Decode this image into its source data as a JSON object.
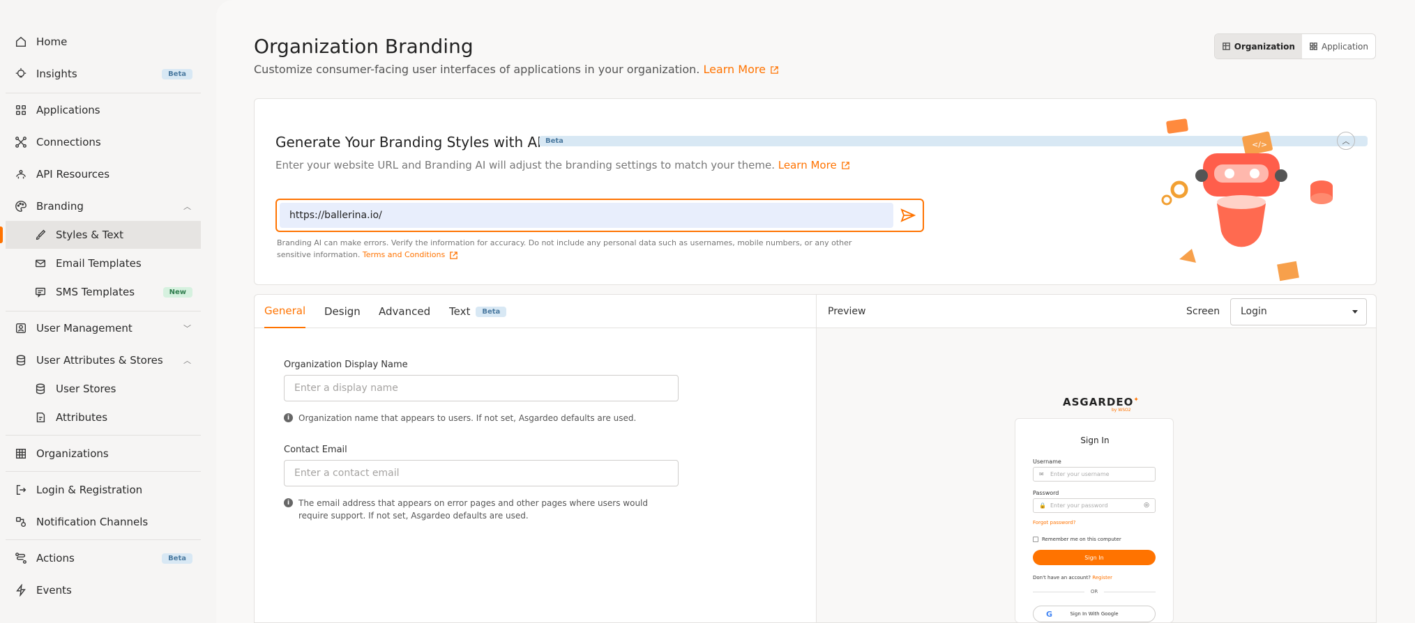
{
  "sidebar": {
    "items": [
      {
        "label": "Home",
        "icon": "home-icon"
      },
      {
        "label": "Insights",
        "icon": "bulb-icon",
        "badge": "Beta"
      },
      {
        "label": "Applications",
        "icon": "grid-icon"
      },
      {
        "label": "Connections",
        "icon": "connections-icon"
      },
      {
        "label": "API Resources",
        "icon": "api-icon"
      },
      {
        "label": "Branding",
        "icon": "palette-icon"
      },
      {
        "label": "Styles & Text",
        "icon": "brush-icon"
      },
      {
        "label": "Email Templates",
        "icon": "mail-icon"
      },
      {
        "label": "SMS Templates",
        "icon": "sms-icon",
        "badge": "New"
      },
      {
        "label": "User Management",
        "icon": "user-icon"
      },
      {
        "label": "User Attributes & Stores",
        "icon": "database-icon"
      },
      {
        "label": "User Stores",
        "icon": "database-icon"
      },
      {
        "label": "Attributes",
        "icon": "attribute-icon"
      },
      {
        "label": "Organizations",
        "icon": "building-icon"
      },
      {
        "label": "Login & Registration",
        "icon": "login-icon"
      },
      {
        "label": "Notification Channels",
        "icon": "channels-icon"
      },
      {
        "label": "Actions",
        "icon": "actions-icon",
        "badge": "Beta"
      },
      {
        "label": "Events",
        "icon": "bolt-icon"
      }
    ]
  },
  "header": {
    "title": "Organization Branding",
    "subtitle": "Customize consumer-facing user interfaces of applications in your organization.",
    "learn_more": "Learn More",
    "toggle": {
      "organization": "Organization",
      "application": "Application"
    }
  },
  "ai": {
    "title": "Generate Your Branding Styles with AI",
    "badge": "Beta",
    "description": "Enter your website URL and Branding AI will adjust the branding settings to match your theme.",
    "learn_more": "Learn More",
    "url_value": "https://ballerina.io/",
    "disclaimer": "Branding AI can make errors. Verify the information for accuracy. Do not include any personal data such as usernames, mobile numbers, or any other sensitive information.",
    "terms": "Terms and Conditions"
  },
  "tabs": {
    "general": "General",
    "design": "Design",
    "advanced": "Advanced",
    "text": "Text",
    "text_badge": "Beta"
  },
  "form": {
    "display_name_label": "Organization Display Name",
    "display_name_placeholder": "Enter a display name",
    "display_name_hint": "Organization name that appears to users. If not set, Asgardeo defaults are used.",
    "contact_email_label": "Contact Email",
    "contact_email_placeholder": "Enter a contact email",
    "contact_email_hint": "The email address that appears on error pages and other pages where users would require support. If not set, Asgardeo defaults are used."
  },
  "preview": {
    "label": "Preview",
    "screen_label": "Screen",
    "screen_value": "Login",
    "logo": "ASGARDEO",
    "logo_sub": "by WSO2",
    "card": {
      "title": "Sign In",
      "username_label": "Username",
      "username_placeholder": "Enter your username",
      "password_label": "Password",
      "password_placeholder": "Enter your password",
      "forgot": "Forgot password?",
      "remember": "Remember me on this computer",
      "signin": "Sign In",
      "no_account": "Don't have an account?",
      "register": "Register",
      "or": "OR",
      "google": "Sign In With Google"
    }
  },
  "colors": {
    "accent": "#ff7300",
    "sidebar_bg": "#f6f5f4",
    "beta_badge": "#d8e8f4",
    "new_badge": "#d6f1df"
  }
}
